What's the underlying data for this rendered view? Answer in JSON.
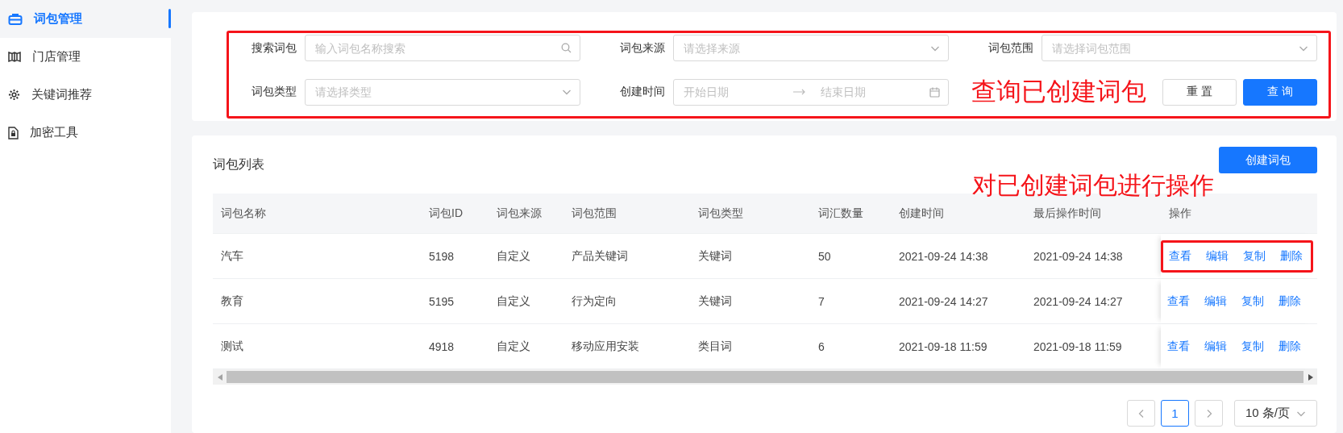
{
  "sidebar": {
    "items": [
      {
        "label": "词包管理",
        "selected": true
      },
      {
        "label": "门店管理",
        "selected": false
      },
      {
        "label": "关键词推荐",
        "selected": false
      },
      {
        "label": "加密工具",
        "selected": false
      }
    ]
  },
  "filters": {
    "fields": [
      {
        "kind": "search",
        "label": "搜索词包",
        "placeholder": "输入词包名称搜索"
      },
      {
        "kind": "select",
        "label": "词包来源",
        "placeholder": "请选择来源"
      },
      {
        "kind": "select",
        "label": "词包范围",
        "placeholder": "请选择词包范围"
      },
      {
        "kind": "select",
        "label": "词包类型",
        "placeholder": "请选择类型"
      },
      {
        "kind": "daterange",
        "label": "创建时间",
        "start_placeholder": "开始日期",
        "end_placeholder": "结束日期"
      }
    ],
    "annotation": "查询已创建词包",
    "buttons": [
      {
        "kind": "default",
        "label": "重 置"
      },
      {
        "kind": "primary",
        "label": "查 询"
      }
    ]
  },
  "table": {
    "title": "词包列表",
    "create_button": "创建词包",
    "annotation": "对已创建词包进行操作",
    "columns": [
      "词包名称",
      "词包ID",
      "词包来源",
      "词包范围",
      "词包类型",
      "词汇数量",
      "创建时间",
      "最后操作时间",
      "操作"
    ],
    "rows": [
      {
        "cells": [
          "汽车",
          "5198",
          "自定义",
          "产品关键词",
          "关键词",
          "50",
          "2021-09-24 14:38",
          "2021-09-24 14:38"
        ],
        "actions": [
          "查看",
          "编辑",
          "复制",
          "删除"
        ],
        "highlighted": true
      },
      {
        "cells": [
          "教育",
          "5195",
          "自定义",
          "行为定向",
          "关键词",
          "7",
          "2021-09-24 14:27",
          "2021-09-24 14:27"
        ],
        "actions": [
          "查看",
          "编辑",
          "复制",
          "删除"
        ],
        "highlighted": false
      },
      {
        "cells": [
          "测试",
          "4918",
          "自定义",
          "移动应用安装",
          "类目词",
          "6",
          "2021-09-18 11:59",
          "2021-09-18 11:59"
        ],
        "actions": [
          "查看",
          "编辑",
          "复制",
          "删除"
        ],
        "highlighted": false
      }
    ]
  },
  "pagination": {
    "pages": [
      {
        "label": "1",
        "selected": true
      }
    ],
    "page_size": "10 条/页"
  }
}
